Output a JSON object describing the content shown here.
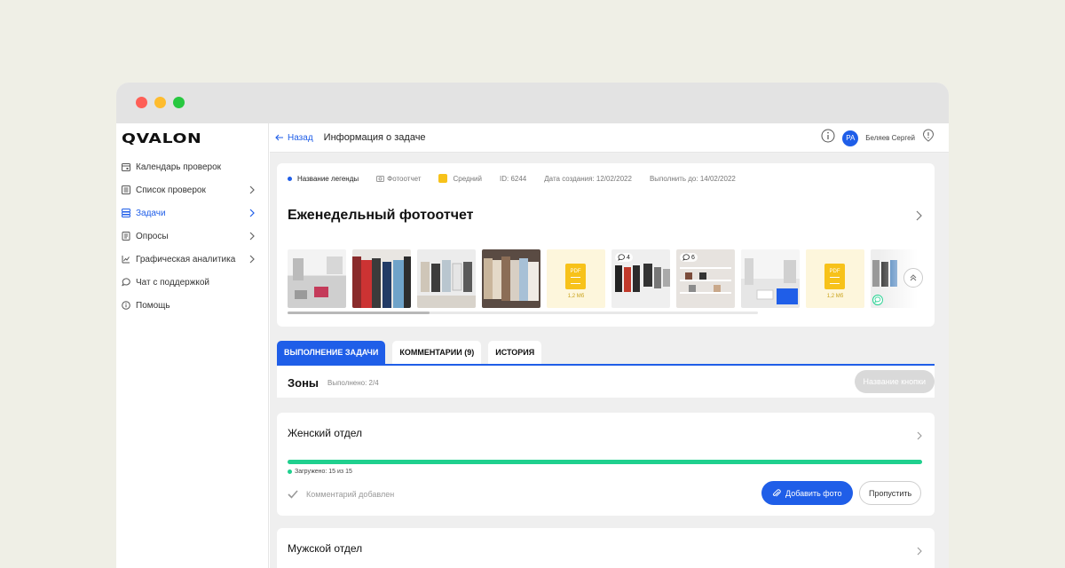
{
  "app": {
    "logo": "QVALON"
  },
  "sidebar": {
    "items": [
      {
        "label": "Календарь проверок",
        "icon": "calendar-icon"
      },
      {
        "label": "Список проверок",
        "icon": "list-icon"
      },
      {
        "label": "Задачи",
        "icon": "tasks-icon"
      },
      {
        "label": "Опросы",
        "icon": "survey-icon"
      },
      {
        "label": "Графическая аналитика",
        "icon": "chart-icon"
      },
      {
        "label": "Чат с поддержкой",
        "icon": "chat-icon"
      },
      {
        "label": "Помощь",
        "icon": "info-icon"
      }
    ]
  },
  "topbar": {
    "back_label": "Назад",
    "title": "Информация о задаче",
    "avatar_initials": "PA",
    "user_name": "Беляев Сергей"
  },
  "task": {
    "legend": "Название легенды",
    "type": "Фотоотчет",
    "priority": "Средний",
    "id": "ID: 6244",
    "created": "Дата создания: 12/02/2022",
    "due": "Выполнить до: 14/02/2022",
    "title": "Еженедельный фотоотчет",
    "attachments": [
      {
        "kind": "photo"
      },
      {
        "kind": "photo"
      },
      {
        "kind": "photo"
      },
      {
        "kind": "photo"
      },
      {
        "kind": "pdf",
        "label": "PDF",
        "size": "1,2 Мб"
      },
      {
        "kind": "photo",
        "comments": "4"
      },
      {
        "kind": "photo",
        "comments": "6"
      },
      {
        "kind": "photo"
      },
      {
        "kind": "pdf",
        "label": "PDF",
        "size": "1,2 Мб"
      },
      {
        "kind": "photo"
      }
    ]
  },
  "tabs": [
    {
      "label": "ВЫПОЛНЕНИЕ ЗАДАЧИ",
      "active": true
    },
    {
      "label": "КОММЕНТАРИИ (9)",
      "active": false
    },
    {
      "label": "ИСТОРИЯ",
      "active": false
    }
  ],
  "zones": {
    "title": "Зоны",
    "done": "Выполнено: 2/4",
    "button_label": "Название кнопки"
  },
  "departments": [
    {
      "title": "Женский отдел",
      "progress": 1.0,
      "loaded": "Загружено: 15 из 15",
      "comment": "Комментарий добавлен",
      "add_photo_label": "Добавить фото",
      "skip_label": "Пропустить"
    },
    {
      "title": "Мужской отдел"
    }
  ],
  "colors": {
    "accent": "#1f5ee8",
    "success": "#1fd08e",
    "priority": "#f7c21a"
  }
}
